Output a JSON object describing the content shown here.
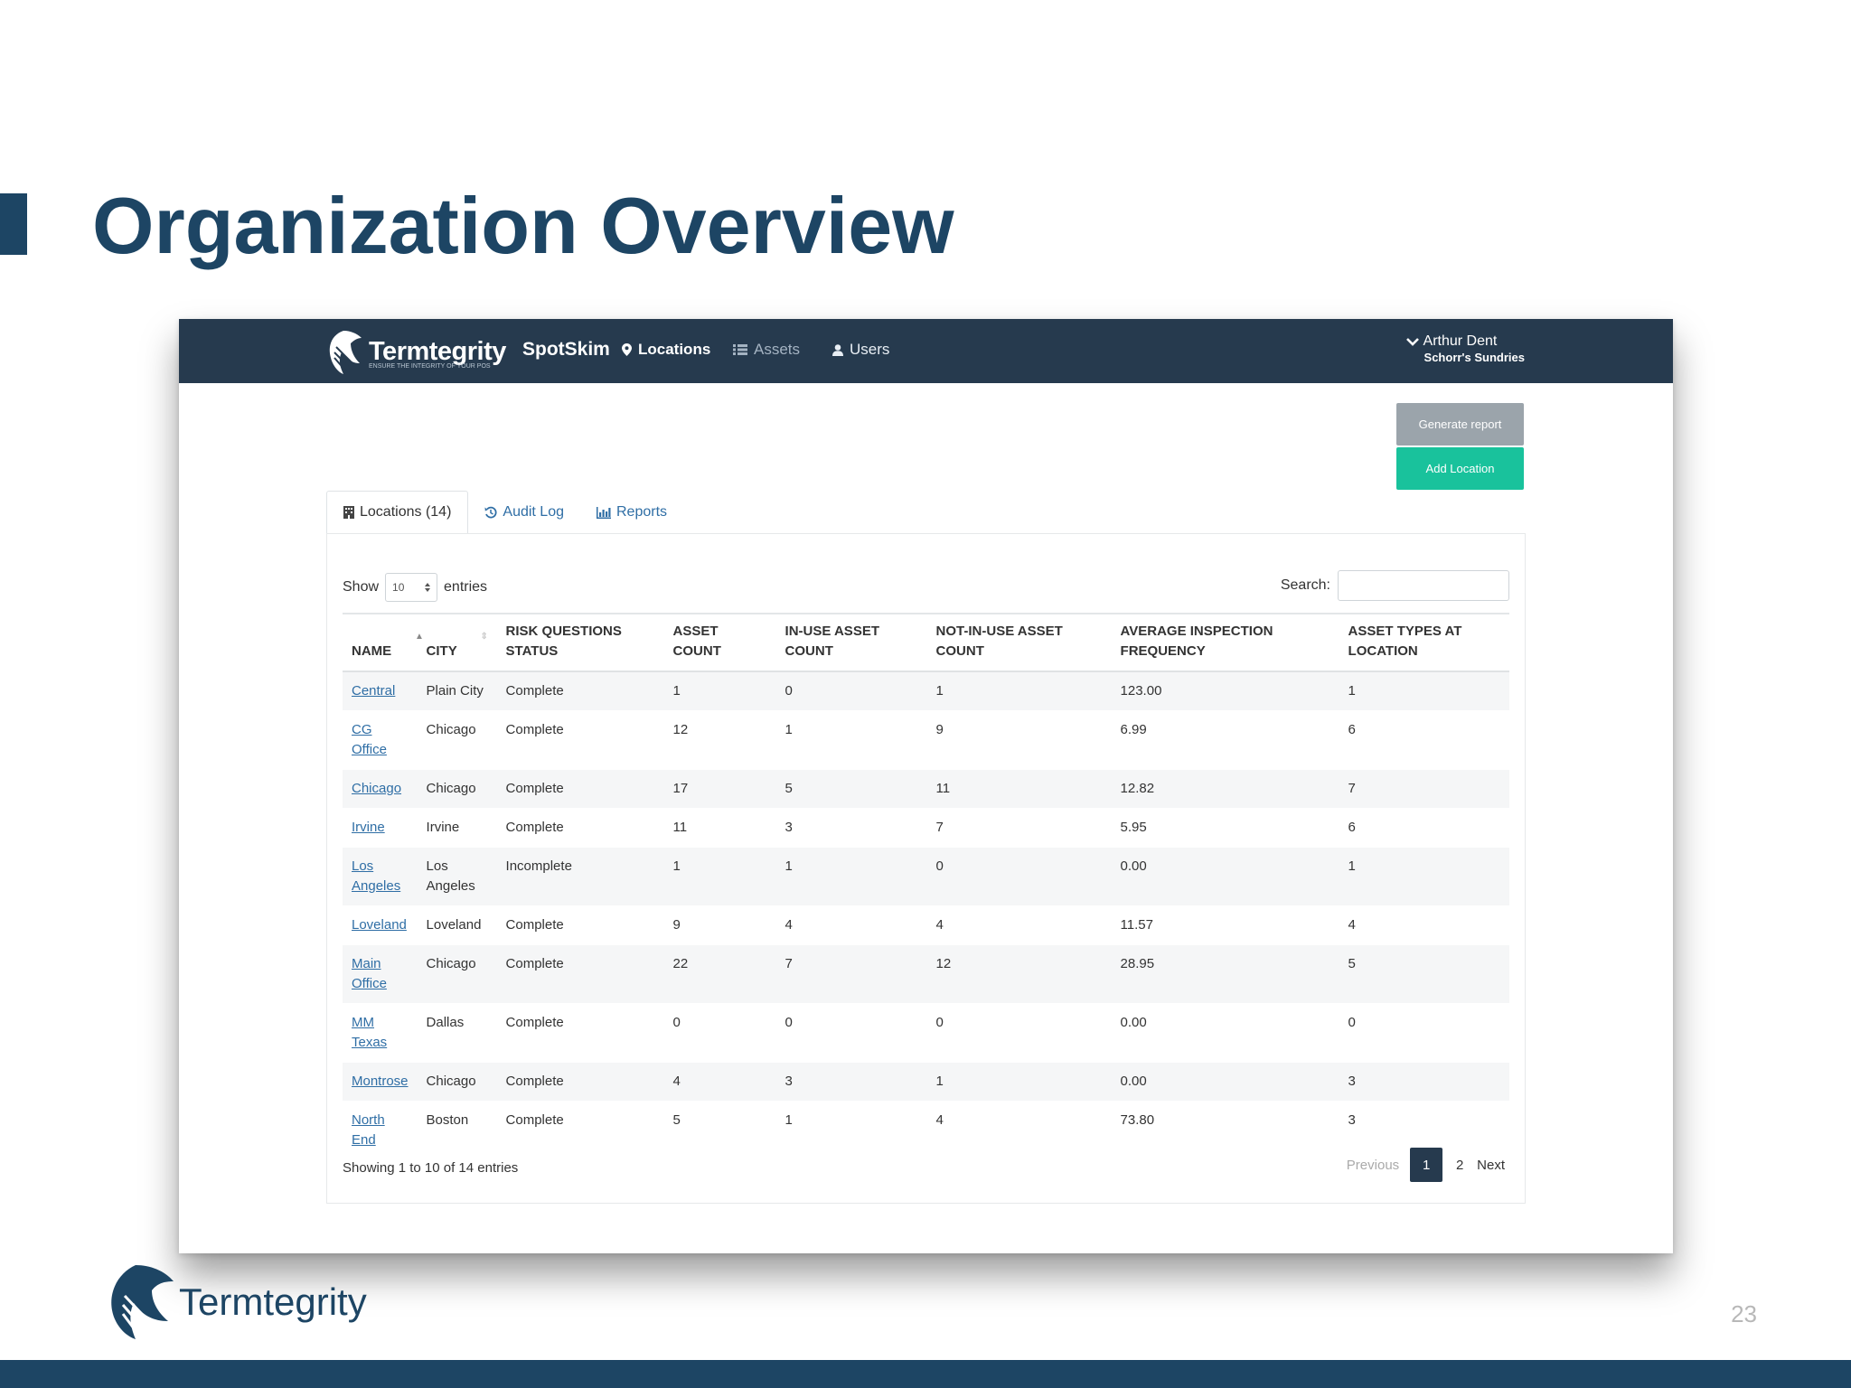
{
  "slide": {
    "title": "Organization Overview",
    "page_number": "23",
    "footer_brand": "Termtegrity"
  },
  "navbar": {
    "brand": "Termtegrity",
    "tagline": "ENSURE THE INTEGRITY OF YOUR POS",
    "app_name": "SpotSkim",
    "items": [
      {
        "label": "Locations",
        "icon": "map-marker-icon"
      },
      {
        "label": "Assets",
        "icon": "list-icon"
      },
      {
        "label": "Users",
        "icon": "user-icon"
      }
    ],
    "user_name": "Arthur Dent",
    "user_org": "Schorr's Sundries"
  },
  "actions": {
    "generate_report": "Generate report",
    "add_location": "Add Location"
  },
  "tabs": [
    {
      "label": "Locations (14)",
      "icon": "building-icon"
    },
    {
      "label": "Audit Log",
      "icon": "history-icon"
    },
    {
      "label": "Reports",
      "icon": "bar-chart-icon"
    }
  ],
  "table_controls": {
    "show_label": "Show",
    "page_size": "10",
    "entries_label": "entries",
    "search_label": "Search:",
    "search_value": ""
  },
  "table": {
    "columns": [
      "NAME",
      "CITY",
      "RISK QUESTIONS STATUS",
      "ASSET COUNT",
      "IN-USE ASSET COUNT",
      "NOT-IN-USE ASSET COUNT",
      "AVERAGE INSPECTION FREQUENCY",
      "ASSET TYPES AT LOCATION"
    ],
    "rows": [
      [
        "Central",
        "Plain City",
        "Complete",
        "1",
        "0",
        "1",
        "123.00",
        "1"
      ],
      [
        "CG Office",
        "Chicago",
        "Complete",
        "12",
        "1",
        "9",
        "6.99",
        "6"
      ],
      [
        "Chicago",
        "Chicago",
        "Complete",
        "17",
        "5",
        "11",
        "12.82",
        "7"
      ],
      [
        "Irvine",
        "Irvine",
        "Complete",
        "11",
        "3",
        "7",
        "5.95",
        "6"
      ],
      [
        "Los Angeles",
        "Los Angeles",
        "Incomplete",
        "1",
        "1",
        "0",
        "0.00",
        "1"
      ],
      [
        "Loveland",
        "Loveland",
        "Complete",
        "9",
        "4",
        "4",
        "11.57",
        "4"
      ],
      [
        "Main Office",
        "Chicago",
        "Complete",
        "22",
        "7",
        "12",
        "28.95",
        "5"
      ],
      [
        "MM Texas",
        "Dallas",
        "Complete",
        "0",
        "0",
        "0",
        "0.00",
        "0"
      ],
      [
        "Montrose",
        "Chicago",
        "Complete",
        "4",
        "3",
        "1",
        "0.00",
        "3"
      ],
      [
        "North End",
        "Boston",
        "Complete",
        "5",
        "1",
        "4",
        "73.80",
        "3"
      ]
    ]
  },
  "pagination": {
    "info": "Showing 1 to 10 of 14 entries",
    "previous": "Previous",
    "pages": [
      "1",
      "2"
    ],
    "current": "1",
    "next": "Next"
  },
  "colors": {
    "navbar": "#263a4e",
    "title": "#1d4564",
    "add_button": "#19c29c",
    "generate_button": "#9ba4ab",
    "link": "#2f6ea5"
  }
}
